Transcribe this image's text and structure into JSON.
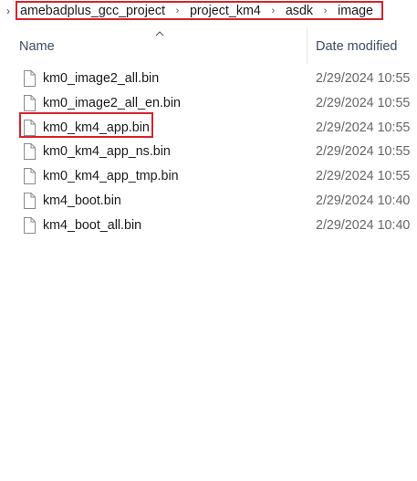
{
  "breadcrumb": {
    "items": [
      {
        "label": "amebadplus_gcc_project"
      },
      {
        "label": "project_km4"
      },
      {
        "label": "asdk"
      },
      {
        "label": "image"
      }
    ]
  },
  "columns": {
    "name": "Name",
    "date_modified": "Date modified",
    "sort": "ascending-by-name"
  },
  "files": [
    {
      "name": "km0_image2_all.bin",
      "date": "2/29/2024 10:55",
      "icon": "file-icon"
    },
    {
      "name": "km0_image2_all_en.bin",
      "date": "2/29/2024 10:55",
      "icon": "file-icon"
    },
    {
      "name": "km0_km4_app.bin",
      "date": "2/29/2024 10:55",
      "icon": "file-icon",
      "highlighted": true
    },
    {
      "name": "km0_km4_app_ns.bin",
      "date": "2/29/2024 10:55",
      "icon": "file-icon"
    },
    {
      "name": "km0_km4_app_tmp.bin",
      "date": "2/29/2024 10:55",
      "icon": "file-icon"
    },
    {
      "name": "km4_boot.bin",
      "date": "2/29/2024 10:40",
      "icon": "file-icon"
    },
    {
      "name": "km4_boot_all.bin",
      "date": "2/29/2024 10:40",
      "icon": "file-icon"
    }
  ],
  "colors": {
    "highlight": "#d9232d",
    "header_text": "#3d4b63",
    "date_text": "#666666"
  }
}
